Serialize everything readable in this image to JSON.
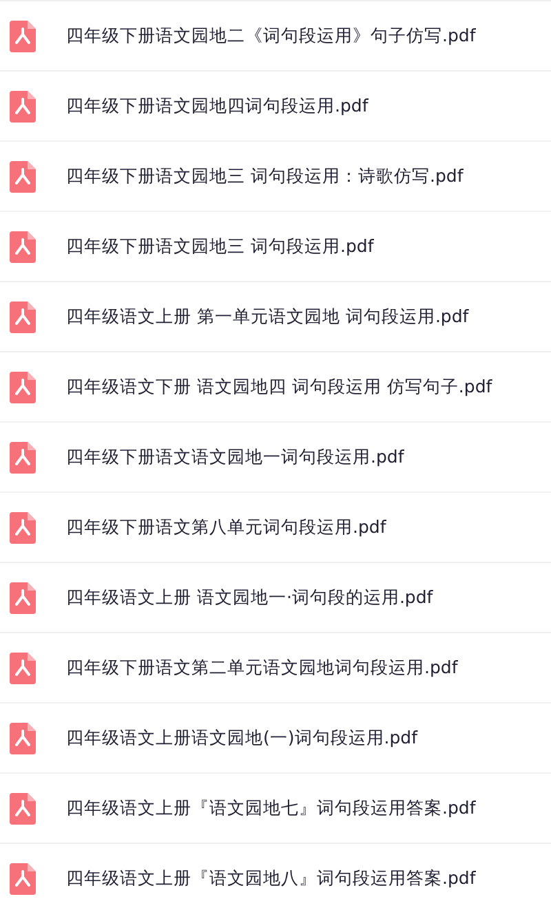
{
  "files": [
    {
      "name": "四年级下册语文园地二《词句段运用》句子仿写.pdf"
    },
    {
      "name": "四年级下册语文园地四词句段运用.pdf"
    },
    {
      "name": "四年级下册语文园地三 词句段运用：诗歌仿写.pdf"
    },
    {
      "name": "四年级下册语文园地三 词句段运用.pdf"
    },
    {
      "name": "四年级语文上册 第一单元语文园地 词句段运用.pdf"
    },
    {
      "name": "四年级语文下册 语文园地四 词句段运用 仿写句子.pdf"
    },
    {
      "name": "四年级下册语文语文园地一词句段运用.pdf"
    },
    {
      "name": "四年级下册语文第八单元词句段运用.pdf"
    },
    {
      "name": "四年级语文上册 语文园地一·词句段的运用.pdf"
    },
    {
      "name": "四年级下册语文第二单元语文园地词句段运用.pdf"
    },
    {
      "name": "四年级语文上册语文园地(一)词句段运用.pdf"
    },
    {
      "name": "四年级语文上册『语文园地七』词句段运用答案.pdf"
    },
    {
      "name": "四年级语文上册『语文园地八』词句段运用答案.pdf"
    }
  ]
}
